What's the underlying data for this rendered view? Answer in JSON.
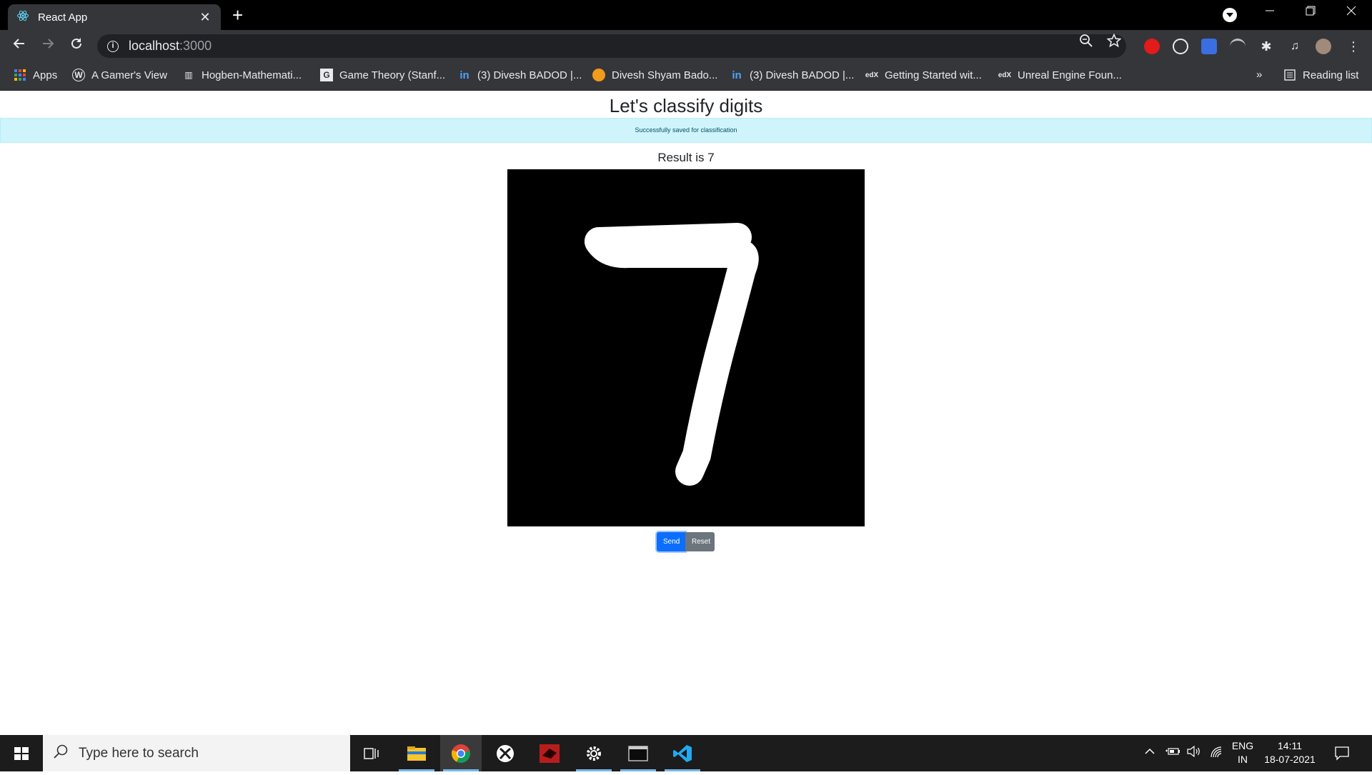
{
  "browser": {
    "tab_title": "React App",
    "tab_close": "✕",
    "new_tab": "+",
    "url_host": "localhost",
    "url_port": ":3000",
    "bookmarks": [
      {
        "label": "Apps",
        "icon": "apps-grid-icon"
      },
      {
        "label": "A Gamer's View",
        "icon": "wordpress-icon"
      },
      {
        "label": "Hogben-Mathemati...",
        "icon": "library-icon"
      },
      {
        "label": "Game Theory (Stanf...",
        "icon": "game-theory-icon"
      },
      {
        "label": "(3) Divesh BADOD |...",
        "icon": "linkedin-icon"
      },
      {
        "label": "Divesh Shyam Bado...",
        "icon": "profile-icon"
      },
      {
        "label": "(3) Divesh BADOD |...",
        "icon": "linkedin-icon"
      },
      {
        "label": "Getting Started wit...",
        "icon": "edx-icon"
      },
      {
        "label": "Unreal Engine Foun...",
        "icon": "edx-icon"
      }
    ],
    "more_bookmarks": "»",
    "reading_list": "Reading list"
  },
  "page": {
    "heading": "Let's classify digits",
    "alert": "Successfully saved for classification",
    "result": "Result is 7",
    "drawn_digit": "7",
    "send_label": "Send",
    "reset_label": "Reset"
  },
  "taskbar": {
    "search_placeholder": "Type here to search",
    "language_top": "ENG",
    "language_bottom": "IN",
    "time": "14:11",
    "date": "18-07-2021"
  },
  "colors": {
    "primary": "#0d6efd",
    "secondary": "#6c757d",
    "alert_bg": "#cff4fc"
  }
}
